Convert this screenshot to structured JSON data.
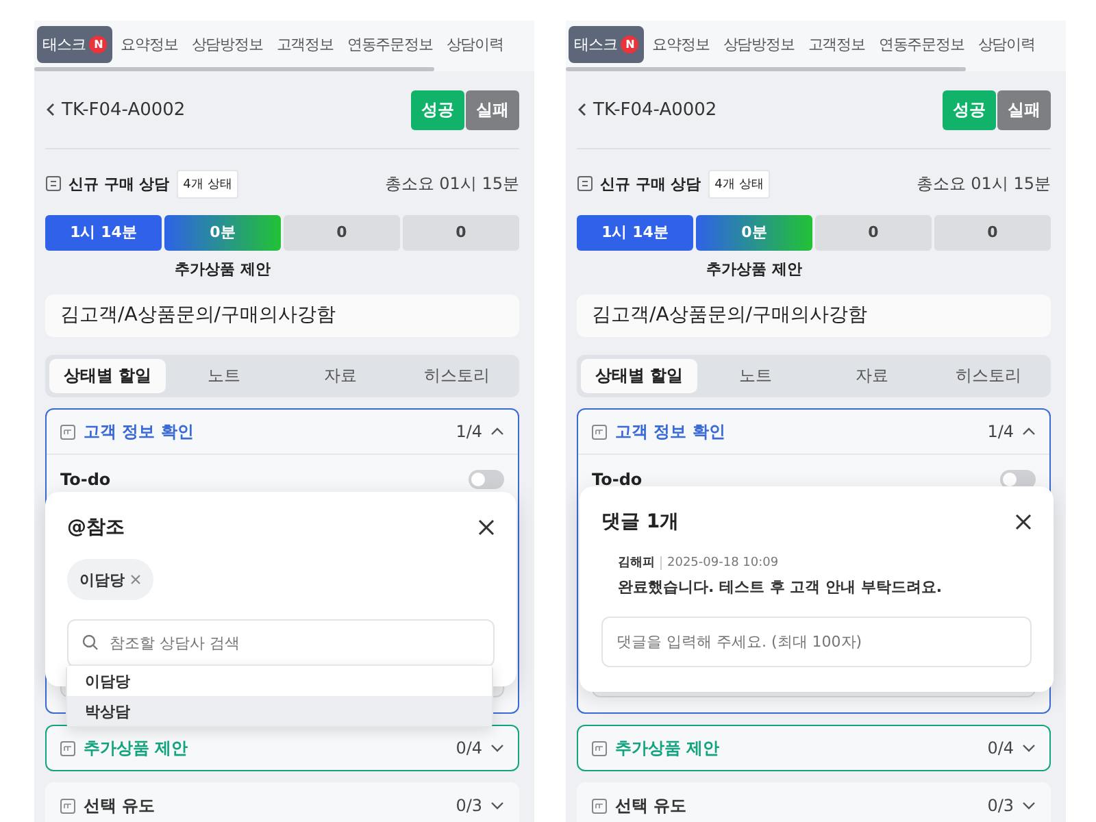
{
  "panels": [
    {
      "top_tabs": [
        {
          "label": "태스크",
          "badge": "N",
          "selected": true
        },
        {
          "label": "요약정보",
          "selected": false
        },
        {
          "label": "상담방정보",
          "selected": false
        },
        {
          "label": "고객정보",
          "selected": false
        },
        {
          "label": "연동주문정보",
          "selected": false
        },
        {
          "label": "상담이력",
          "selected": false
        }
      ],
      "task_id": "TK-F04-A0002",
      "actions": [
        {
          "label": "성공",
          "kind": "success"
        },
        {
          "label": "실패",
          "kind": "fail"
        }
      ],
      "flow": {
        "title": "신규 구매 상담",
        "badge": "4개 상태",
        "total": "총소요 01시 15분",
        "current_label": "추가상품 제안",
        "steps": [
          {
            "label": "1시 14분",
            "kind": "done"
          },
          {
            "label": "0분",
            "kind": "current"
          },
          {
            "label": "0",
            "kind": "pending"
          },
          {
            "label": "0",
            "kind": "pending"
          }
        ]
      },
      "summary": "김고객/A상품문의/구매의사강함",
      "sub_tabs": [
        {
          "label": "상태별 할일",
          "selected": true
        },
        {
          "label": "노트",
          "selected": false
        },
        {
          "label": "자료",
          "selected": false
        },
        {
          "label": "히스토리",
          "selected": false
        }
      ],
      "sections": [
        {
          "title": "고객 정보 확인",
          "count": "1/4",
          "expanded": true,
          "highlighted": true,
          "color": "#3a6ad6"
        },
        {
          "title": "추가상품 제안",
          "count": "0/4",
          "expanded": false,
          "highlighted": true,
          "color": "#14a37f"
        },
        {
          "title": "선택 유도",
          "count": "0/3",
          "expanded": false,
          "highlighted": false,
          "color": "#333333"
        }
      ],
      "todo": {
        "label": "To-do",
        "on": false
      },
      "overlay": {
        "kind": "mention",
        "title": "@참조",
        "chips": [
          {
            "label": "이담당"
          }
        ],
        "search_placeholder": "참조할 상담사 검색",
        "suggestions": [
          {
            "label": "이담당",
            "selected": false
          },
          {
            "label": "박상담",
            "selected": true
          }
        ]
      }
    },
    {
      "top_tabs": [
        {
          "label": "태스크",
          "badge": "N",
          "selected": true
        },
        {
          "label": "요약정보",
          "selected": false
        },
        {
          "label": "상담방정보",
          "selected": false
        },
        {
          "label": "고객정보",
          "selected": false
        },
        {
          "label": "연동주문정보",
          "selected": false
        },
        {
          "label": "상담이력",
          "selected": false
        }
      ],
      "task_id": "TK-F04-A0002",
      "actions": [
        {
          "label": "성공",
          "kind": "success"
        },
        {
          "label": "실패",
          "kind": "fail"
        }
      ],
      "flow": {
        "title": "신규 구매 상담",
        "badge": "4개 상태",
        "total": "총소요 01시 15분",
        "current_label": "추가상품 제안",
        "steps": [
          {
            "label": "1시 14분",
            "kind": "done"
          },
          {
            "label": "0분",
            "kind": "current"
          },
          {
            "label": "0",
            "kind": "pending"
          },
          {
            "label": "0",
            "kind": "pending"
          }
        ]
      },
      "summary": "김고객/A상품문의/구매의사강함",
      "sub_tabs": [
        {
          "label": "상태별 할일",
          "selected": true
        },
        {
          "label": "노트",
          "selected": false
        },
        {
          "label": "자료",
          "selected": false
        },
        {
          "label": "히스토리",
          "selected": false
        }
      ],
      "sections": [
        {
          "title": "고객 정보 확인",
          "count": "1/4",
          "expanded": true,
          "highlighted": true,
          "color": "#3a6ad6"
        },
        {
          "title": "추가상품 제안",
          "count": "0/4",
          "expanded": false,
          "highlighted": true,
          "color": "#14a37f"
        },
        {
          "title": "선택 유도",
          "count": "0/3",
          "expanded": false,
          "highlighted": false,
          "color": "#333333"
        }
      ],
      "todo": {
        "label": "To-do",
        "on": false
      },
      "overlay": {
        "kind": "comments",
        "title": "댓글 1개",
        "comments": [
          {
            "author": "김해피",
            "time": "2025-09-18 10:09",
            "text": "완료했습니다. 테스트 후 고객 안내 부탁드려요."
          }
        ],
        "input_placeholder": "댓글을 입력해 주세요. (최대 100자)"
      }
    }
  ]
}
